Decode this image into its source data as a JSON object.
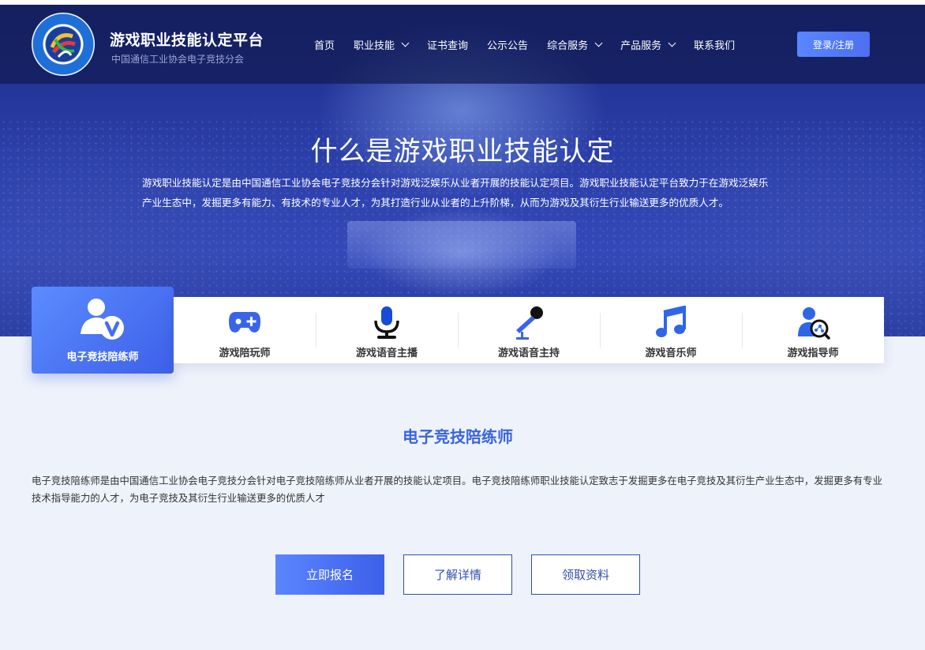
{
  "header": {
    "brand_title": "游戏职业技能认定平台",
    "brand_subtitle": "中国通信工业协会电子竞技分会",
    "nav": [
      {
        "label": "首页",
        "has_dropdown": false
      },
      {
        "label": "职业技能",
        "has_dropdown": true
      },
      {
        "label": "证书查询",
        "has_dropdown": false
      },
      {
        "label": "公示公告",
        "has_dropdown": false
      },
      {
        "label": "综合服务",
        "has_dropdown": true
      },
      {
        "label": "产品服务",
        "has_dropdown": true
      },
      {
        "label": "联系我们",
        "has_dropdown": false
      }
    ],
    "login_label": "登录/注册"
  },
  "hero": {
    "title": "什么是游戏职业技能认定",
    "description": "游戏职业技能认定是由中国通信工业协会电子竞技分会针对游戏泛娱乐从业者开展的技能认定项目。游戏职业技能认定平台致力于在游戏泛娱乐产业生态中，发掘更多有能力、有技术的专业人才，为其打造行业从业者的上升阶梯，从而为游戏及其衍生行业输送更多的优质人才。"
  },
  "categories": [
    {
      "label": "电子竞技陪练师",
      "icon": "coach-user-icon",
      "active": true
    },
    {
      "label": "游戏陪玩师",
      "icon": "gamepad-icon",
      "active": false
    },
    {
      "label": "游戏语音主播",
      "icon": "microphone-icon",
      "active": false
    },
    {
      "label": "游戏语音主持",
      "icon": "hand-mic-icon",
      "active": false
    },
    {
      "label": "游戏音乐师",
      "icon": "music-note-icon",
      "active": false
    },
    {
      "label": "游戏指导师",
      "icon": "user-search-icon",
      "active": false
    }
  ],
  "detail": {
    "title": "电子竞技陪练师",
    "description": "电子竞技陪练师是由中国通信工业协会电子竞技分会针对电子竞技陪练师从业者开展的技能认定项目。电子竞技陪练师职业技能认定致志于发掘更多在电子竞技及其衍生产业生态中，发掘更多有专业技术指导能力的人才，为电子竞技及其衍生行业输送更多的优质人才"
  },
  "actions": {
    "signup_label": "立即报名",
    "details_label": "了解详情",
    "materials_label": "领取资料"
  },
  "colors": {
    "accent": "#3d5fe8",
    "title_blue": "#3a64dd",
    "outline_blue": "#2f4fae"
  }
}
